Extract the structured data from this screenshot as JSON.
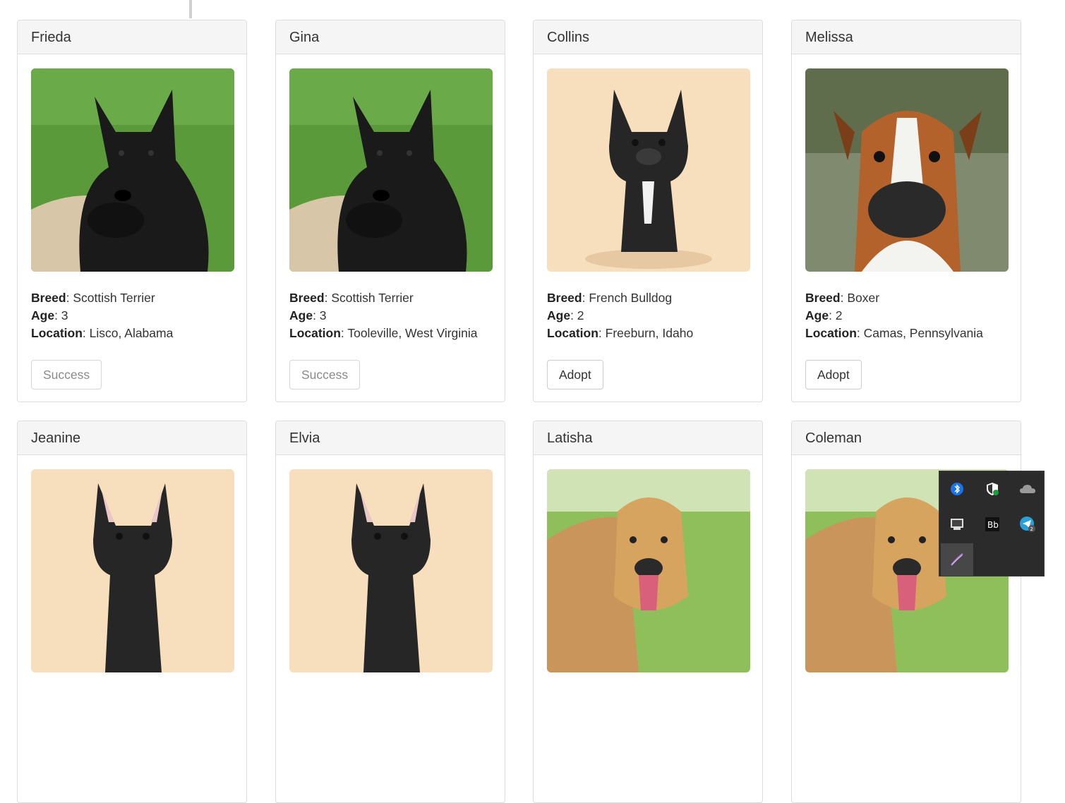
{
  "labels": {
    "breed": "Breed",
    "age": "Age",
    "location": "Location",
    "separator": ": "
  },
  "pets": [
    {
      "name": "Frieda",
      "breed": "Scottish Terrier",
      "age": "3",
      "location": "Lisco, Alabama",
      "button": "Success",
      "button_enabled": false,
      "photo": "scottish-terrier-photo"
    },
    {
      "name": "Gina",
      "breed": "Scottish Terrier",
      "age": "3",
      "location": "Tooleville, West Virginia",
      "button": "Success",
      "button_enabled": false,
      "photo": "scottish-terrier-photo"
    },
    {
      "name": "Collins",
      "breed": "French Bulldog",
      "age": "2",
      "location": "Freeburn, Idaho",
      "button": "Adopt",
      "button_enabled": true,
      "photo": "french-bulldog-photo"
    },
    {
      "name": "Melissa",
      "breed": "Boxer",
      "age": "2",
      "location": "Camas, Pennsylvania",
      "button": "Adopt",
      "button_enabled": true,
      "photo": "boxer-photo"
    },
    {
      "name": "Jeanine",
      "photo": "french-bulldog-photo"
    },
    {
      "name": "Elvia",
      "photo": "french-bulldog-photo"
    },
    {
      "name": "Latisha",
      "photo": "golden-retriever-photo"
    },
    {
      "name": "Coleman",
      "photo": "golden-retriever-photo"
    }
  ],
  "tray": {
    "icons": [
      "bluetooth-icon",
      "windows-security-icon",
      "onedrive-icon",
      "display-icon",
      "app-icon",
      "telegram-icon",
      "pen-icon"
    ],
    "telegram_badge": "2"
  },
  "colors": {
    "header_bg": "#f5f5f5",
    "border": "#dddddd",
    "tray_bg": "#2b2b2b"
  }
}
